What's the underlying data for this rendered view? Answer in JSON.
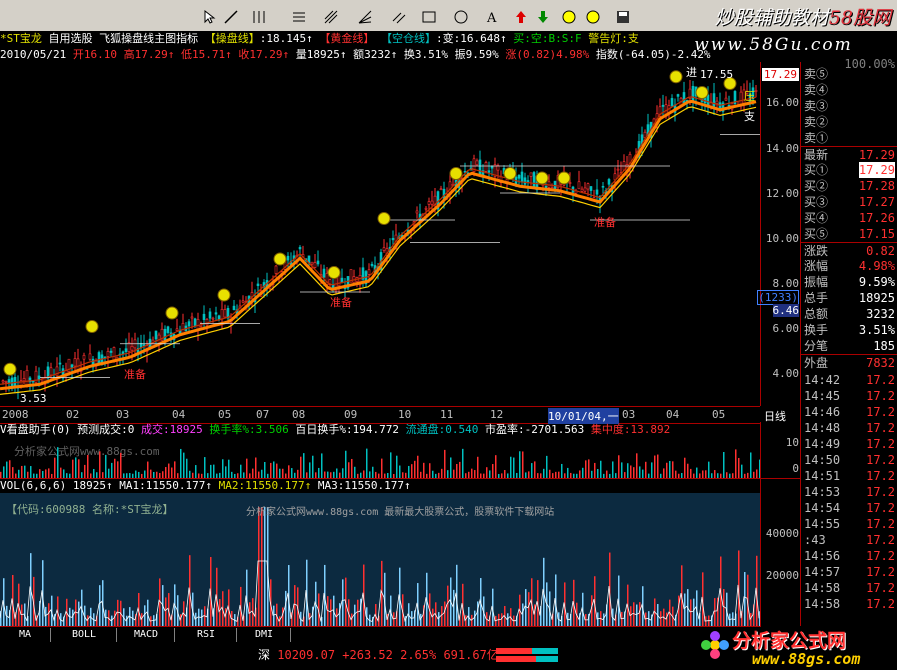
{
  "toolbar": {
    "brand_main": "炒股辅助教材",
    "brand_accent": "58股网",
    "site_url": "www.58Gu.com"
  },
  "infobar": {
    "stock": "*ST宝龙",
    "menu1": "自用选股",
    "menu2": "飞狐操盘线主图指标",
    "tag1": "【操盘线】",
    "val1": ":18.145↑",
    "tag2": "【黄金线】",
    "tag3": "【空仓线】",
    "val3": ":变:16.648↑",
    "flags": "买:空:B:S:F",
    "warn": "警告灯:支"
  },
  "infobar2": {
    "date": "2010/05/21",
    "open": "开16.10",
    "high": "高17.29↑",
    "low": "低15.71↑",
    "close": "收17.29↑",
    "vol": "量18925↑",
    "amt": "额3232↑",
    "turnover": "换3.51%",
    "amp": "振9.59%",
    "chg": "涨(0.82)4.98%",
    "index": "指数(-64.05)-2.42%"
  },
  "yaxis": {
    "ticks": [
      "17.29",
      "16.00",
      "14.00",
      "12.00",
      "10.00",
      "8.00",
      "6.00",
      "4.00"
    ],
    "boxed_top": "(1233)",
    "boxed_bottom": "6.46"
  },
  "xaxis": {
    "labels": [
      "2008",
      "02",
      "03",
      "04",
      "05",
      "07",
      "08",
      "09",
      "10",
      "11",
      "12",
      "10/01/04,一",
      "03",
      "04",
      "05"
    ],
    "period": "日线"
  },
  "chart_labels": {
    "high_mark": "17.55",
    "low_mark": "3.53",
    "sell_tag": "压",
    "sup_tag": "支",
    "buy_tag": "进",
    "warn1": "准备",
    "warn2": "准备",
    "warn3": "准备",
    "warn4": "准备"
  },
  "sub1": {
    "name": "V看盘助手(0)",
    "pred": "预测成交:0",
    "vol_lab": "成交:18925",
    "turn_lab": "换手率%:3.506",
    "hundred": "百日换手%:194.772",
    "float_lab": "流通盘:0.540",
    "pe": "市盈率:-2701.563",
    "conc": "集中度:13.892",
    "watermark": "分析家公式网www.88gs.com",
    "axis_top": "10",
    "axis_bottom": "0"
  },
  "sub2": {
    "name": "VOL(6,6,6)",
    "val": "18925↑",
    "ma1": "MA1:11550.177↑",
    "ma2": "MA2:11550.177↑",
    "ma3": "MA3:11550.177↑",
    "code": "【代码:600988 名称:*ST宝龙】",
    "ad": "分析家公式网www.88gs.com 最新最大股票公式，股票软件下载网站",
    "axis_ticks": [
      "40000",
      "20000"
    ]
  },
  "tabs": [
    "MA",
    "BOLL",
    "MACD",
    "RSI",
    "DMI"
  ],
  "status": {
    "market": "深",
    "index": "10209.07",
    "change": "+263.52",
    "pct": "2.65%",
    "amount": "691.67亿",
    "logo": "分析家公式网",
    "logo_url": "www.88gs.com"
  },
  "quote": {
    "top": "100.00%",
    "sells": [
      {
        "label": "卖⑤",
        "val": ""
      },
      {
        "label": "卖④",
        "val": ""
      },
      {
        "label": "卖③",
        "val": ""
      },
      {
        "label": "卖②",
        "val": ""
      },
      {
        "label": "卖①",
        "val": ""
      }
    ],
    "latest": {
      "label": "最新",
      "val": "17.29"
    },
    "buys": [
      {
        "label": "买①",
        "val": "17.29"
      },
      {
        "label": "买②",
        "val": "17.28"
      },
      {
        "label": "买③",
        "val": "17.27"
      },
      {
        "label": "买④",
        "val": "17.26"
      },
      {
        "label": "买⑤",
        "val": "17.15"
      }
    ],
    "stats": [
      {
        "label": "涨跌",
        "val": "0.82"
      },
      {
        "label": "涨幅",
        "val": "4.98%"
      },
      {
        "label": "振幅",
        "val": "9.59%"
      },
      {
        "label": "总手",
        "val": "18925"
      },
      {
        "label": "总额",
        "val": "3232"
      },
      {
        "label": "换手",
        "val": "3.51%"
      },
      {
        "label": "分笔",
        "val": "185"
      },
      {
        "label": "外盘",
        "val": "7832"
      }
    ],
    "ticks": [
      {
        "t": "14:42",
        "p": "17.2"
      },
      {
        "t": "14:45",
        "p": "17.2"
      },
      {
        "t": "14:46",
        "p": "17.2"
      },
      {
        "t": "14:48",
        "p": "17.2"
      },
      {
        "t": "14:49",
        "p": "17.2"
      },
      {
        "t": "14:50",
        "p": "17.2"
      },
      {
        "t": "14:51",
        "p": "17.2"
      },
      {
        "t": "14:53",
        "p": "17.2"
      },
      {
        "t": "14:54",
        "p": "17.2"
      },
      {
        "t": "14:55",
        "p": "17.2"
      },
      {
        "t": ":43",
        "p": "17.2"
      },
      {
        "t": "14:56",
        "p": "17.2"
      },
      {
        "t": "14:57",
        "p": "17.2"
      },
      {
        "t": "14:58",
        "p": "17.2"
      },
      {
        "t": "14:58",
        "p": "17.2"
      }
    ]
  },
  "colors": {
    "up": "#ff3030",
    "down": "#00c0c0",
    "axis": "#aa0000",
    "line_main": "#ff8000"
  }
}
